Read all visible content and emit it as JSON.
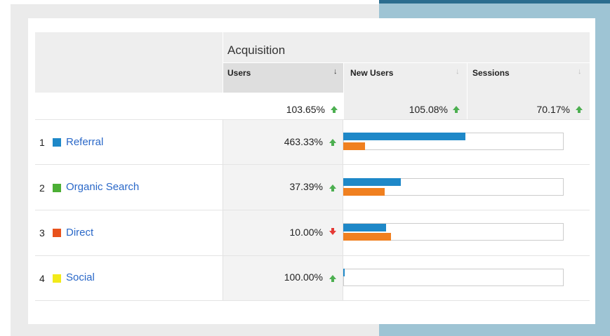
{
  "acquisition": {
    "title": "Acquisition"
  },
  "columns": [
    {
      "label": "Users",
      "sort_icon": "sort-down-arrow-icon",
      "active": true
    },
    {
      "label": "New Users",
      "sort_icon": "sort-down-arrow-icon",
      "active": false
    },
    {
      "label": "Sessions",
      "sort_icon": "sort-down-arrow-icon",
      "active": false
    }
  ],
  "totals": {
    "users": {
      "value": "103.65%",
      "trend": "up"
    },
    "new_users": {
      "value": "105.08%",
      "trend": "up"
    },
    "sessions": {
      "value": "70.17%",
      "trend": "up"
    }
  },
  "rows": [
    {
      "num": "1",
      "channel": "Referral",
      "color": "#1e88c8",
      "users": "463.33%",
      "trend": "up",
      "bar_blue": 1.0,
      "bar_orange": 0.18
    },
    {
      "num": "2",
      "channel": "Organic Search",
      "color": "#4caf35",
      "users": "37.39%",
      "trend": "up",
      "bar_blue": 0.47,
      "bar_orange": 0.34
    },
    {
      "num": "3",
      "channel": "Direct",
      "color": "#e8521c",
      "users": "10.00%",
      "trend": "down",
      "bar_blue": 0.35,
      "bar_orange": 0.39
    },
    {
      "num": "4",
      "channel": "Social",
      "color": "#f2ea1a",
      "users": "100.00%",
      "trend": "up",
      "bar_blue": 0.01,
      "bar_orange": 0.0
    }
  ],
  "colors": {
    "bar_primary": "#1e88c8",
    "bar_secondary": "#f08020",
    "trend_up": "#4caf50",
    "trend_down": "#e53935",
    "link": "#2a68c8"
  }
}
